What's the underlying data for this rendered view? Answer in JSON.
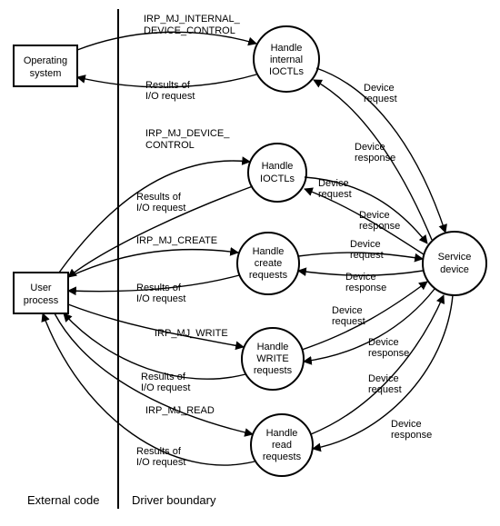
{
  "left_region_label": "External code",
  "right_region_label": "Driver boundary",
  "nodes": {
    "os": {
      "l1": "Operating",
      "l2": "system"
    },
    "user": {
      "l1": "User",
      "l2": "process"
    },
    "svc": {
      "l1": "Service",
      "l2": "device"
    },
    "h_int": {
      "l1": "Handle",
      "l2": "internal",
      "l3": "IOCTLs"
    },
    "h_ioc": {
      "l1": "Handle",
      "l2": "IOCTLs"
    },
    "h_cre": {
      "l1": "Handle",
      "l2": "create",
      "l3": "requests"
    },
    "h_wri": {
      "l1": "Handle",
      "l2": "WRITE",
      "l3": "requests"
    },
    "h_rea": {
      "l1": "Handle",
      "l2": "read",
      "l3": "requests"
    }
  },
  "irps": {
    "internal": {
      "l1": "IRP_MJ_INTERNAL_",
      "l2": "DEVICE_CONTROL"
    },
    "ioctl": {
      "l1": "IRP_MJ_DEVICE_",
      "l2": "CONTROL"
    },
    "create": "IRP_MJ_CREATE",
    "write": "IRP_MJ_WRITE",
    "read": "IRP_MJ_READ"
  },
  "labels": {
    "results": {
      "l1": "Results of",
      "l2": "I/O request"
    },
    "dev_req": {
      "l1": "Device",
      "l2": "request"
    },
    "dev_res": {
      "l1": "Device",
      "l2": "response"
    }
  }
}
